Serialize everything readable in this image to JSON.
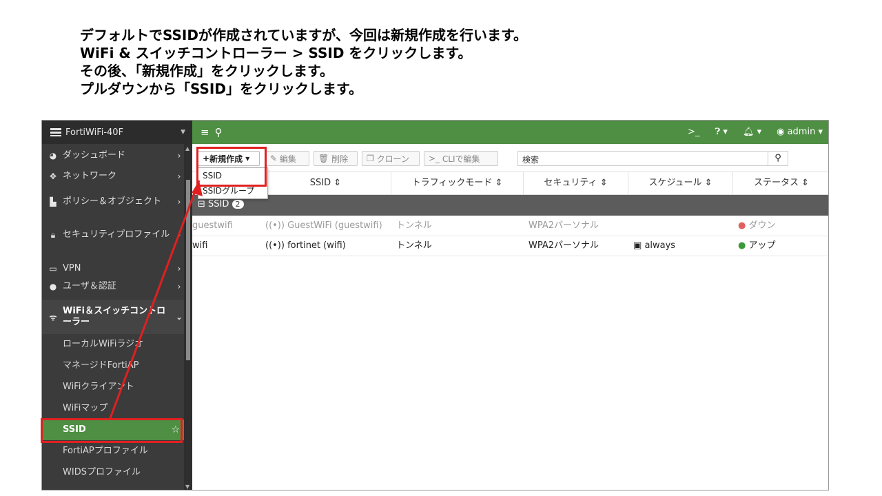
{
  "instructions": [
    "デフォルトでSSIDが作成されていますが、今回は新規作成を行います。",
    "WiFi & スイッチコントローラー > SSID をクリックします。",
    "その後、「新規作成」をクリックします。",
    "プルダウンから「SSID」をクリックします。"
  ],
  "sidebar": {
    "device": "FortiWiFi-40F",
    "items": [
      {
        "label": "ダッシュボード",
        "icon": "dashboard-icon"
      },
      {
        "label": "ネットワーク",
        "icon": "network-icon"
      },
      {
        "label": "ポリシー＆オブジェクト",
        "icon": "policy-icon"
      },
      {
        "label": "セキュリティプロファイル",
        "icon": "lock-icon"
      },
      {
        "label": "VPN",
        "icon": "vpn-icon"
      },
      {
        "label": "ユーザ＆認証",
        "icon": "user-icon"
      },
      {
        "label": "WiFi＆スイッチコントローラー",
        "icon": "wifi-icon"
      }
    ],
    "subitems": [
      "ローカルWiFiラジオ",
      "マネージドFortiAP",
      "WiFiクライアント",
      "WiFiマップ",
      "SSID",
      "FortiAPプロファイル",
      "WIDSプロファイル"
    ]
  },
  "topbar": {
    "user": "admin"
  },
  "toolbar": {
    "new_label": "新規作成",
    "edit_label": "編集",
    "delete_label": "削除",
    "clone_label": "クローン",
    "cli_label": "CLIで編集",
    "search_placeholder": "検索"
  },
  "dropdown": {
    "options": [
      "SSID",
      "SSIDグループ"
    ]
  },
  "table": {
    "columns": [
      "SSID",
      "トラフィックモード",
      "セキュリティ",
      "スケジュール",
      "ステータス"
    ],
    "group": {
      "label": "SSID",
      "count": "2"
    },
    "rows": [
      {
        "interface": "guestwifi",
        "ssid": "GuestWiFi (guestwifi)",
        "mode": "トンネル",
        "security": "WPA2パーソナル",
        "schedule": "",
        "status": "ダウン"
      },
      {
        "interface": "wifi",
        "ssid": "fortinet (wifi)",
        "mode": "トンネル",
        "security": "WPA2パーソナル",
        "schedule": "always",
        "status": "アップ"
      }
    ]
  }
}
